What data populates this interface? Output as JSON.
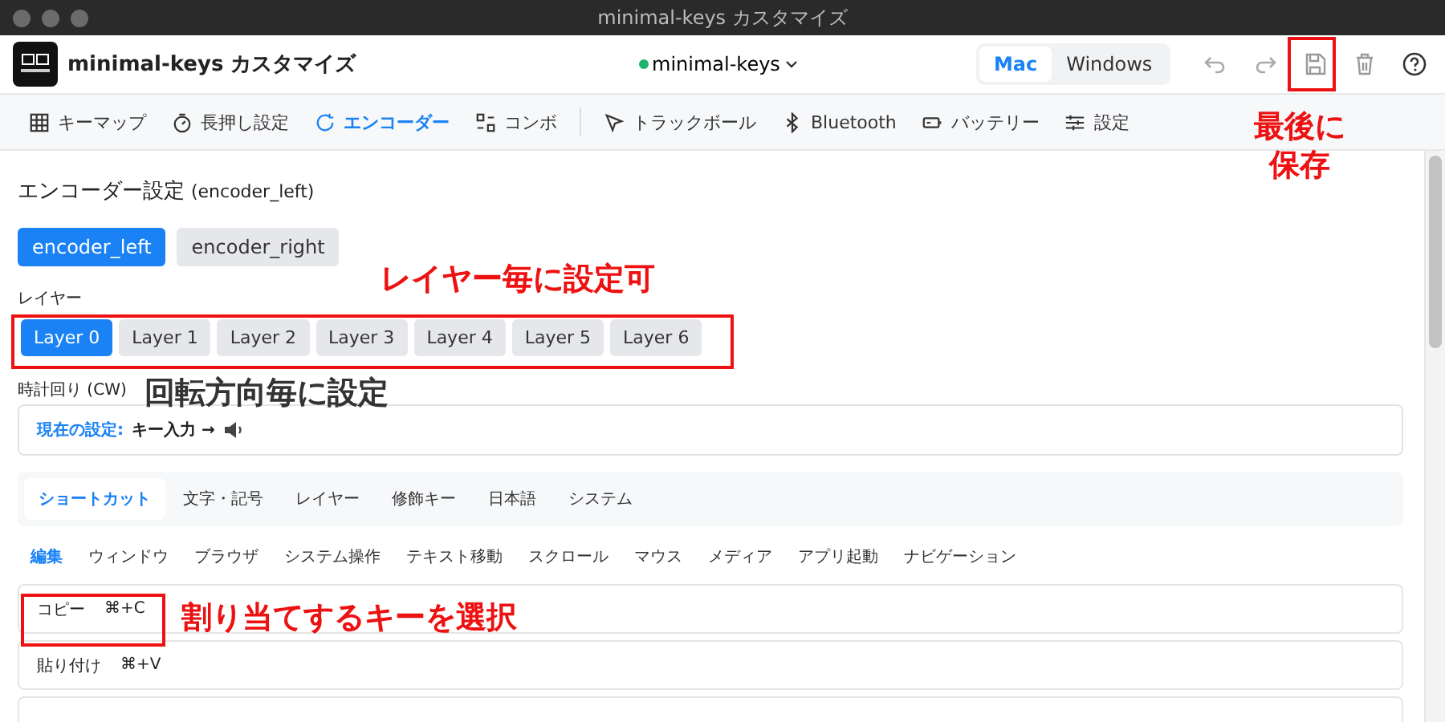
{
  "window": {
    "title": "minimal-keys カスタマイズ"
  },
  "app": {
    "name": "minimal-keys カスタマイズ"
  },
  "device": {
    "name": "minimal-keys",
    "connected": true
  },
  "os_toggle": [
    {
      "label": "Mac",
      "selected": true
    },
    {
      "label": "Windows",
      "selected": false
    }
  ],
  "nav": [
    {
      "label": "キーマップ",
      "selected": false
    },
    {
      "label": "長押し設定",
      "selected": false
    },
    {
      "label": "エンコーダー",
      "selected": true
    },
    {
      "label": "コンボ",
      "selected": false
    },
    {
      "label": "トラックボール",
      "selected": false
    },
    {
      "label": "Bluetooth",
      "selected": false
    },
    {
      "label": "バッテリー",
      "selected": false
    },
    {
      "label": "設定",
      "selected": false
    }
  ],
  "section": {
    "title": "エンコーダー設定",
    "subtitle": "(encoder_left)"
  },
  "encoders": [
    {
      "label": "encoder_left",
      "selected": true
    },
    {
      "label": "encoder_right",
      "selected": false
    }
  ],
  "layer_label": "レイヤー",
  "layers": [
    {
      "label": "Layer 0",
      "selected": true
    },
    {
      "label": "Layer 1",
      "selected": false
    },
    {
      "label": "Layer 2",
      "selected": false
    },
    {
      "label": "Layer 3",
      "selected": false
    },
    {
      "label": "Layer 4",
      "selected": false
    },
    {
      "label": "Layer 5",
      "selected": false
    },
    {
      "label": "Layer 6",
      "selected": false
    }
  ],
  "direction_label": "時計回り (CW)",
  "current": {
    "label": "現在の設定:",
    "value": "キー入力 →"
  },
  "categories": [
    {
      "label": "ショートカット",
      "selected": true
    },
    {
      "label": "文字・記号",
      "selected": false
    },
    {
      "label": "レイヤー",
      "selected": false
    },
    {
      "label": "修飾キー",
      "selected": false
    },
    {
      "label": "日本語",
      "selected": false
    },
    {
      "label": "システム",
      "selected": false
    }
  ],
  "subcategories": [
    {
      "label": "編集",
      "selected": true
    },
    {
      "label": "ウィンドウ",
      "selected": false
    },
    {
      "label": "ブラウザ",
      "selected": false
    },
    {
      "label": "システム操作",
      "selected": false
    },
    {
      "label": "テキスト移動",
      "selected": false
    },
    {
      "label": "スクロール",
      "selected": false
    },
    {
      "label": "マウス",
      "selected": false
    },
    {
      "label": "メディア",
      "selected": false
    },
    {
      "label": "アプリ起動",
      "selected": false
    },
    {
      "label": "ナビゲーション",
      "selected": false
    }
  ],
  "keys": [
    {
      "label": "コピー",
      "shortcut": "⌘+C"
    },
    {
      "label": "貼り付け",
      "shortcut": "⌘+V"
    }
  ],
  "annotations": [
    {
      "text": "最後に保存",
      "color": "#ee1111"
    },
    {
      "text": "レイヤー毎に設定可",
      "color": "#ee1111"
    },
    {
      "text": "回転方向毎に設定",
      "color": "#333333"
    },
    {
      "text": "割り当てするキーを選択",
      "color": "#ee1111"
    }
  ]
}
